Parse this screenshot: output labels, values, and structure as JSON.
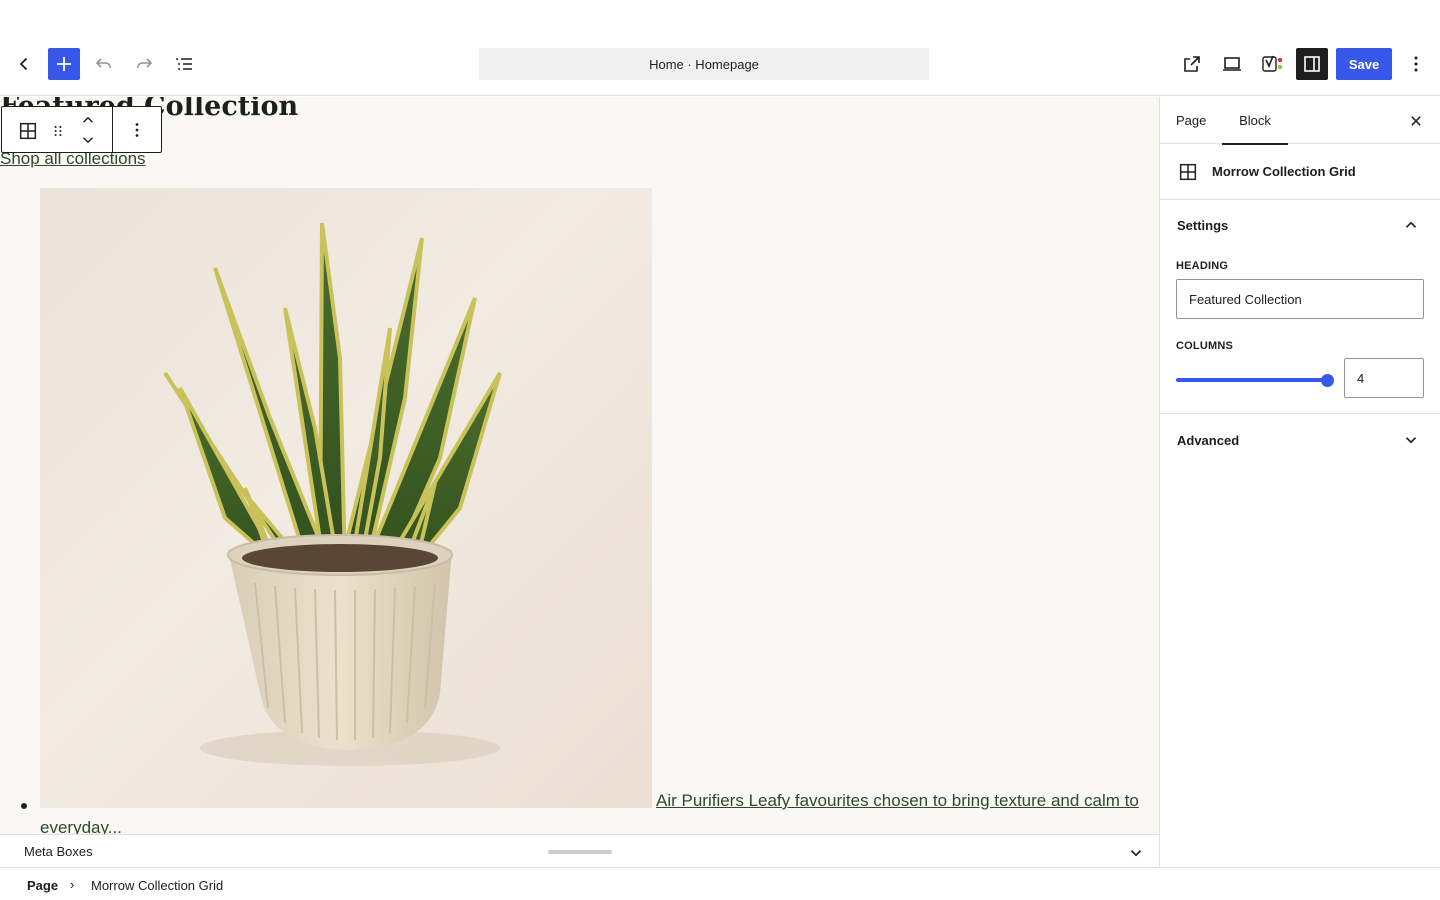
{
  "header": {
    "document_title": "Home · Homepage",
    "save_label": "Save",
    "inserter_icon": "plus-icon",
    "back_icon": "chevron-left-icon",
    "undo_icon": "undo-icon",
    "redo_icon": "redo-icon",
    "list_view_icon": "list-view-icon",
    "view_page_icon": "external-link-icon",
    "preview_icon": "desktop-icon",
    "yoast_icon": "yoast-icon",
    "settings_icon": "sidebar-toggle-icon",
    "options_icon": "more-vertical-icon"
  },
  "canvas": {
    "heading": "Featured Collection",
    "shop_link": "Shop all collections",
    "product": {
      "image_icon": "snake-plant-image",
      "link_line1": "Air Purifiers Leafy favourites chosen to bring texture and calm to",
      "link_line2": "everyday..."
    },
    "block_toolbar": {
      "block_icon": "grid-icon",
      "drag_icon": "drag-handle-icon",
      "move_up_icon": "chevron-up-icon",
      "move_down_icon": "chevron-down-icon",
      "options_icon": "more-vertical-icon"
    }
  },
  "meta_boxes": {
    "title": "Meta Boxes"
  },
  "breadcrumb": {
    "root": "Page",
    "separator": "›",
    "current": "Morrow Collection Grid"
  },
  "sidebar": {
    "tabs": [
      {
        "label": "Page",
        "active": false
      },
      {
        "label": "Block",
        "active": true
      }
    ],
    "block_name": "Morrow Collection Grid",
    "settings": {
      "title": "Settings",
      "expanded": true,
      "heading_label": "HEADING",
      "heading_value": "Featured Collection",
      "columns_label": "COLUMNS",
      "columns_value": "4",
      "columns_max_fraction": 1.0
    },
    "advanced": {
      "title": "Advanced",
      "expanded": false
    }
  },
  "colors": {
    "accent": "#3858e9",
    "canvas_bg": "#f9f8f4",
    "link": "#2c4a2e",
    "dark": "#1e1e1e"
  }
}
